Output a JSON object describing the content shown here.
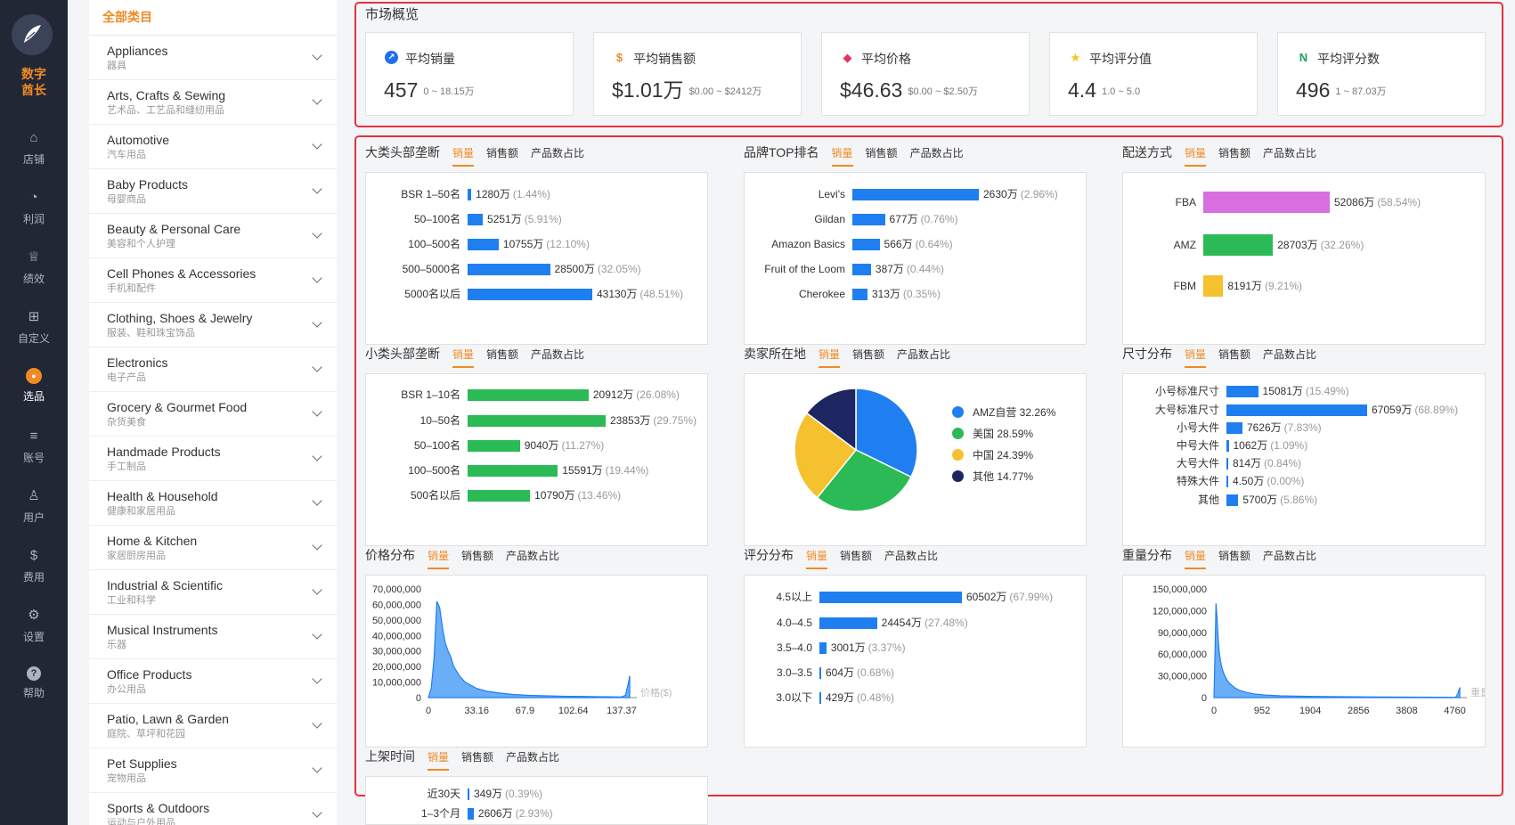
{
  "nav": {
    "brand_line1": "数字",
    "brand_line2": "酋长",
    "items": [
      {
        "label": "店铺",
        "icon": "home-icon"
      },
      {
        "label": "利润",
        "icon": "money-bag-icon"
      },
      {
        "label": "绩效",
        "icon": "trophy-icon"
      },
      {
        "label": "自定义",
        "icon": "grid-icon"
      },
      {
        "label": "选品",
        "icon": "select-icon"
      },
      {
        "label": "账号",
        "icon": "list-icon"
      },
      {
        "label": "用户",
        "icon": "user-icon"
      },
      {
        "label": "费用",
        "icon": "dollar-icon"
      },
      {
        "label": "设置",
        "icon": "gear-icon"
      },
      {
        "label": "帮助",
        "icon": "help-icon"
      }
    ],
    "active": "选品",
    "colors": {
      "bg": "#222736",
      "active_icon": "#f08a24"
    }
  },
  "categories": {
    "header": "全部类目",
    "items": [
      {
        "en": "Appliances",
        "zh": "器具"
      },
      {
        "en": "Arts, Crafts & Sewing",
        "zh": "艺术品、工艺品和缝纫用品"
      },
      {
        "en": "Automotive",
        "zh": "汽车用品"
      },
      {
        "en": "Baby Products",
        "zh": "母婴商品"
      },
      {
        "en": "Beauty & Personal Care",
        "zh": "美容和个人护理"
      },
      {
        "en": "Cell Phones & Accessories",
        "zh": "手机和配件"
      },
      {
        "en": "Clothing, Shoes & Jewelry",
        "zh": "服装、鞋和珠宝饰品"
      },
      {
        "en": "Electronics",
        "zh": "电子产品"
      },
      {
        "en": "Grocery & Gourmet Food",
        "zh": "杂货美食"
      },
      {
        "en": "Handmade Products",
        "zh": "手工制品"
      },
      {
        "en": "Health & Household",
        "zh": "健康和家居用品"
      },
      {
        "en": "Home & Kitchen",
        "zh": "家居厨房用品"
      },
      {
        "en": "Industrial & Scientific",
        "zh": "工业和科学"
      },
      {
        "en": "Musical Instruments",
        "zh": "乐器"
      },
      {
        "en": "Office Products",
        "zh": "办公用品"
      },
      {
        "en": "Patio, Lawn & Garden",
        "zh": "庭院、草坪和花园"
      },
      {
        "en": "Pet Supplies",
        "zh": "宠物用品"
      },
      {
        "en": "Sports & Outdoors",
        "zh": "运动与户外用品"
      }
    ]
  },
  "overview": {
    "title": "市场概览",
    "kpis": [
      {
        "label": "平均销量",
        "value": "457",
        "range": "0 ~ 18.15万",
        "icon": "sales-icon",
        "color": "#1e6ff0"
      },
      {
        "label": "平均销售额",
        "value": "$1.01万",
        "range": "$0.00 ~ $2412万",
        "icon": "dollar-icon",
        "color": "#f08a24"
      },
      {
        "label": "平均价格",
        "value": "$46.63",
        "range": "$0.00 ~ $2.50万",
        "icon": "price-tag-icon",
        "color": "#e5335d"
      },
      {
        "label": "平均评分值",
        "value": "4.4",
        "range": "1.0 ~ 5.0",
        "icon": "star-icon",
        "color": "#f5c518"
      },
      {
        "label": "平均评分数",
        "value": "496",
        "range": "1 ~ 87.03万",
        "icon": "review-count-icon",
        "color": "#1aa35a"
      }
    ]
  },
  "tabs": [
    "销量",
    "销售额",
    "产品数占比"
  ],
  "colors": {
    "blue": "#1f7ff0",
    "green": "#2bba55",
    "magenta": "#d86ee0",
    "yellow": "#f5c12e",
    "navy": "#1d2660",
    "accent": "#f08a24",
    "alert": "#e5333f"
  },
  "chart_data": [
    {
      "id": "big-category",
      "title": "大类头部垄断",
      "type": "bar",
      "orientation": "horizontal",
      "categories": [
        "BSR 1–50名",
        "50–100名",
        "100–500名",
        "500–5000名",
        "5000名以后"
      ],
      "values": [
        1280,
        5251,
        10755,
        28500,
        43130
      ],
      "value_labels": [
        "1280万",
        "5251万",
        "10755万",
        "28500万",
        "43130万"
      ],
      "pct_labels": [
        "(1.44%)",
        "(5.91%)",
        "(12.10%)",
        "(32.05%)",
        "(48.51%)"
      ],
      "unit": "万",
      "color": "#1f7ff0",
      "xlim": [
        0,
        43130
      ]
    },
    {
      "id": "brand-top",
      "title": "品牌TOP排名",
      "type": "bar",
      "orientation": "horizontal",
      "categories": [
        "Levi's",
        "Gildan",
        "Amazon Basics",
        "Fruit of the Loom",
        "Cherokee"
      ],
      "values": [
        2630,
        677,
        566,
        387,
        313
      ],
      "value_labels": [
        "2630万",
        "677万",
        "566万",
        "387万",
        "313万"
      ],
      "pct_labels": [
        "(2.96%)",
        "(0.76%)",
        "(0.64%)",
        "(0.44%)",
        "(0.35%)"
      ],
      "unit": "万",
      "color": "#1f7ff0",
      "xlim": [
        0,
        2630
      ]
    },
    {
      "id": "delivery",
      "title": "配送方式",
      "type": "bar",
      "orientation": "horizontal",
      "categories": [
        "FBA",
        "AMZ",
        "FBM"
      ],
      "values": [
        52086,
        28703,
        8191
      ],
      "value_labels": [
        "52086万",
        "28703万",
        "8191万"
      ],
      "pct_labels": [
        "(58.54%)",
        "(32.26%)",
        "(9.21%)"
      ],
      "unit": "万",
      "colors": [
        "#d86ee0",
        "#2bba55",
        "#f5c12e"
      ],
      "xlim": [
        0,
        52086
      ]
    },
    {
      "id": "sub-category",
      "title": "小类头部垄断",
      "type": "bar",
      "orientation": "horizontal",
      "categories": [
        "BSR 1–10名",
        "10–50名",
        "50–100名",
        "100–500名",
        "500名以后"
      ],
      "values": [
        20912,
        23853,
        9040,
        15591,
        10790
      ],
      "value_labels": [
        "20912万",
        "23853万",
        "9040万",
        "15591万",
        "10790万"
      ],
      "pct_labels": [
        "(26.08%)",
        "(29.75%)",
        "(11.27%)",
        "(19.44%)",
        "(13.46%)"
      ],
      "unit": "万",
      "color": "#2bba55",
      "xlim": [
        0,
        23853
      ]
    },
    {
      "id": "seller-location",
      "title": "卖家所在地",
      "type": "pie",
      "categories": [
        "AMZ自营",
        "美国",
        "中国",
        "其他"
      ],
      "values": [
        32.26,
        28.59,
        24.39,
        14.77
      ],
      "labels": [
        "AMZ自营 32.26%",
        "美国 28.59%",
        "中国 24.39%",
        "其他 14.77%"
      ],
      "colors": [
        "#1f7ff0",
        "#2bba55",
        "#f5c12e",
        "#1d2660"
      ],
      "legend": "right"
    },
    {
      "id": "size",
      "title": "尺寸分布",
      "type": "bar",
      "orientation": "horizontal",
      "categories": [
        "小号标准尺寸",
        "大号标准尺寸",
        "小号大件",
        "中号大件",
        "大号大件",
        "特殊大件",
        "其他"
      ],
      "values": [
        15081,
        67059,
        7626,
        1062,
        814,
        4.5,
        5700
      ],
      "value_labels": [
        "15081万",
        "67059万",
        "7626万",
        "1062万",
        "814万",
        "4.50万",
        "5700万"
      ],
      "pct_labels": [
        "(15.49%)",
        "(68.89%)",
        "(7.83%)",
        "(1.09%)",
        "(0.84%)",
        "(0.00%)",
        "(5.86%)"
      ],
      "unit": "万",
      "color": "#1f7ff0",
      "xlim": [
        0,
        67059
      ]
    },
    {
      "id": "price",
      "title": "价格分布",
      "type": "area",
      "xlabel": "价格($)",
      "x": [
        0,
        2,
        4,
        6,
        8,
        10,
        12,
        14,
        16,
        18,
        20,
        22,
        24,
        26,
        28,
        30,
        34,
        38,
        42,
        46,
        50,
        55,
        60,
        65,
        70,
        80,
        90,
        100,
        110,
        120,
        130,
        137,
        140,
        142,
        143
      ],
      "values": [
        0,
        6000000,
        25000000,
        62000000,
        58000000,
        45000000,
        35000000,
        30000000,
        26000000,
        20000000,
        17000000,
        14000000,
        12000000,
        10000000,
        9000000,
        8000000,
        6000000,
        5000000,
        4000000,
        3500000,
        3000000,
        2500000,
        2000000,
        1800000,
        1500000,
        1200000,
        1000000,
        800000,
        700000,
        600000,
        500000,
        400000,
        1500000,
        9000000,
        14000000
      ],
      "xticks": [
        "0",
        "33.16",
        "67.9",
        "102.64",
        "137.37"
      ],
      "yticks": [
        "0",
        "10,000,000",
        "20,000,000",
        "30,000,000",
        "40,000,000",
        "50,000,000",
        "60,000,000",
        "70,000,000"
      ],
      "xlim": [
        0,
        143
      ],
      "ylim": [
        0,
        70000000
      ],
      "color": "#1f7ff0"
    },
    {
      "id": "rating",
      "title": "评分分布",
      "type": "bar",
      "orientation": "horizontal",
      "categories": [
        "4.5以上",
        "4.0–4.5",
        "3.5–4.0",
        "3.0–3.5",
        "3.0以下"
      ],
      "values": [
        60502,
        24454,
        3001,
        604,
        429
      ],
      "value_labels": [
        "60502万",
        "24454万",
        "3001万",
        "604万",
        "429万"
      ],
      "pct_labels": [
        "(67.99%)",
        "(27.48%)",
        "(3.37%)",
        "(0.68%)",
        "(0.48%)"
      ],
      "unit": "万",
      "color": "#1f7ff0",
      "xlim": [
        0,
        60502
      ]
    },
    {
      "id": "weight",
      "title": "重量分布",
      "type": "area",
      "xlabel": "重量(g)",
      "x": [
        0,
        20,
        40,
        60,
        80,
        100,
        130,
        160,
        200,
        250,
        300,
        400,
        500,
        650,
        800,
        1000,
        1300,
        1600,
        2000,
        2500,
        3000,
        3500,
        4000,
        4500,
        4760,
        4800,
        4840
      ],
      "values": [
        0,
        60000000,
        130000000,
        110000000,
        85000000,
        65000000,
        50000000,
        40000000,
        32000000,
        25000000,
        20000000,
        14000000,
        10000000,
        7000000,
        5000000,
        3500000,
        2500000,
        2000000,
        1500000,
        1200000,
        1000000,
        800000,
        600000,
        500000,
        400000,
        5000000,
        14000000
      ],
      "xticks": [
        "0",
        "952",
        "1904",
        "2856",
        "3808",
        "4760"
      ],
      "yticks": [
        "0",
        "30,000,000",
        "60,000,000",
        "90,000,000",
        "120,000,000",
        "150,000,000"
      ],
      "xlim": [
        0,
        4840
      ],
      "ylim": [
        0,
        150000000
      ],
      "color": "#1f7ff0"
    },
    {
      "id": "listing-time",
      "title": "上架时间",
      "type": "bar",
      "orientation": "horizontal",
      "categories": [
        "近30天",
        "1–3个月"
      ],
      "values": [
        349,
        2606
      ],
      "value_labels": [
        "349万",
        "2606万"
      ],
      "pct_labels": [
        "(0.39%)",
        "(2.93%)"
      ],
      "unit": "万",
      "color": "#1f7ff0",
      "xlim": [
        0,
        60502
      ]
    }
  ]
}
